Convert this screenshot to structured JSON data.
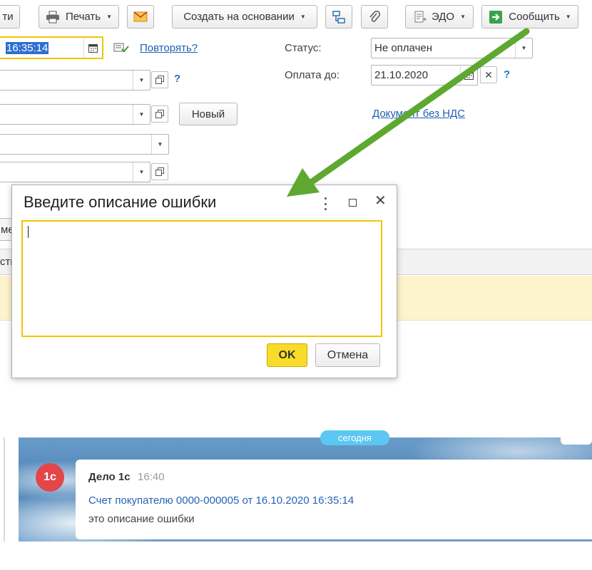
{
  "toolbar": {
    "partial_left_label": "ти",
    "print_label": "Печать",
    "create_based_label": "Создать на основании",
    "edo_label": "ЭДО",
    "report_label": "Сообщить"
  },
  "form": {
    "datetime_value": "16:35:14",
    "repeat_link": "Повторять?",
    "status_label": "Статус:",
    "status_value": "Не оплачен",
    "pay_until_label": "Оплата до:",
    "pay_until_value": "21.10.2020",
    "help_mark": "?",
    "new_button": "Новый",
    "vat_link": "Документ без НДС",
    "partial_row_a": "ме",
    "partial_row_b": "ств"
  },
  "dialog": {
    "title": "Введите описание ошибки",
    "textarea_value": "",
    "ok_label": "OK",
    "cancel_label": "Отмена"
  },
  "chat": {
    "day_label": "сегодня",
    "avatar_text": "1с",
    "sender": "Дело 1с",
    "time": "16:40",
    "link_text": "Счет покупателю 0000-000005 от 16.10.2020 16:35:14",
    "message": "это описание ошибки"
  },
  "colors": {
    "accent_yellow": "#f9dc29",
    "focus_border": "#f2c500",
    "link_blue": "#1f5fb0",
    "arrow_green": "#5ea832",
    "avatar_red": "#e4454b",
    "highlight_row": "#fdf3cc"
  }
}
